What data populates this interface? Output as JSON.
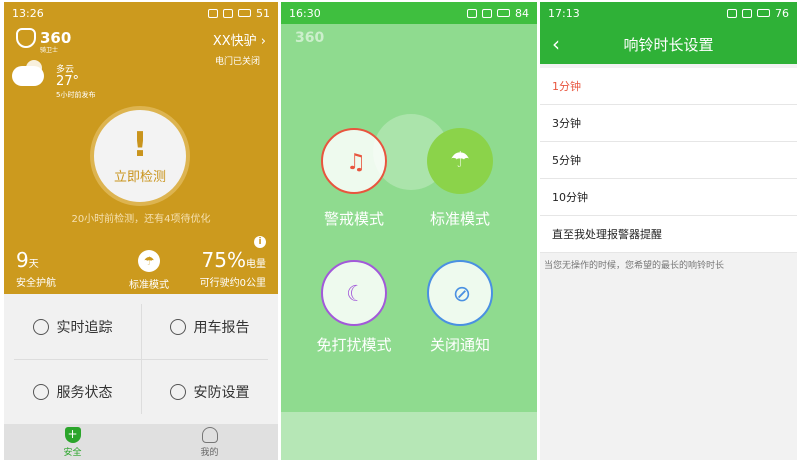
{
  "screen1": {
    "status": {
      "time": "13:26",
      "battery": "51"
    },
    "brand": "360",
    "brand_sub": "骑卫士",
    "device_name": "XX快驴 ›",
    "door_status": "电门已关闭",
    "weather": {
      "condition": "多云",
      "temp": "27°",
      "published": "5小时前发布"
    },
    "check_button": {
      "mark": "!",
      "label": "立即检测"
    },
    "hint": "20小时前检测，还有4项待优化",
    "info_icon": "i",
    "stats": {
      "days_num": "9",
      "days_unit": "天",
      "days_caption": "安全护航",
      "mode_label": "标准模式",
      "battery_num": "75%",
      "battery_unit": "电量",
      "battery_caption": "可行驶约0公里"
    },
    "grid": [
      "实时追踪",
      "用车报告",
      "服务状态",
      "安防设置"
    ],
    "tabs": [
      "安全",
      "我的"
    ]
  },
  "screen2": {
    "status": {
      "time": "16:30",
      "battery": "84"
    },
    "brand": "360",
    "modes": [
      "警戒模式",
      "标准模式",
      "免打扰模式",
      "关闭通知"
    ],
    "colors": {
      "alert": "#e8553e",
      "standard": "#8bd34a",
      "dnd": "#a259d9",
      "off": "#4a90e2"
    }
  },
  "screen3": {
    "status": {
      "time": "17:13",
      "battery": "76"
    },
    "back": "‹",
    "title": "响铃时长设置",
    "options": [
      "1分钟",
      "3分钟",
      "5分钟",
      "10分钟",
      "直至我处理报警器提醒"
    ],
    "selected_index": 0,
    "note": "当您无操作的时候，您希望的最长的响铃时长"
  }
}
